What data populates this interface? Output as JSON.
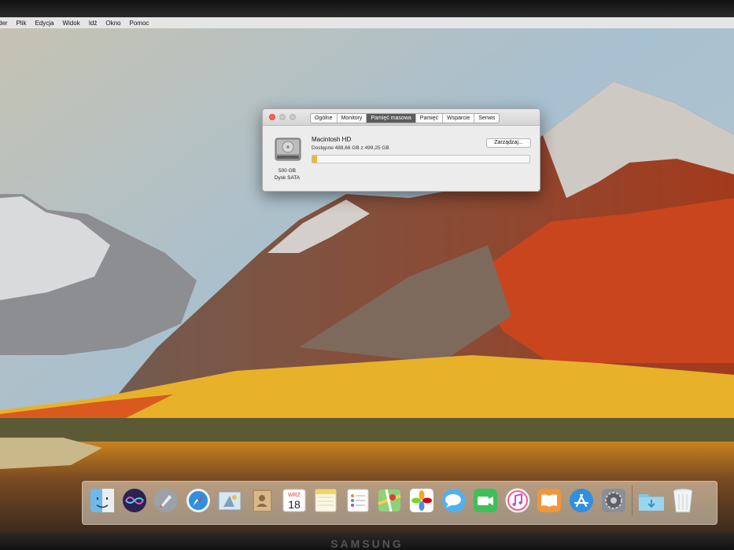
{
  "menubar": {
    "items": [
      "der",
      "Plik",
      "Edycja",
      "Widok",
      "Idź",
      "Okno",
      "Pomoc"
    ]
  },
  "about_window": {
    "tabs": [
      "Ogólne",
      "Monitory",
      "Pamięć masowa",
      "Pamięć",
      "Wsparcie",
      "Serwis"
    ],
    "active_tab": "Pamięć masowa",
    "disk": {
      "icon": "hard-drive-icon",
      "size_label": "500 GB",
      "type_label": "Dysk SATA"
    },
    "volume": {
      "name": "Macintosh HD",
      "available": "Dostępne 488,66 GB z 499,25 GB",
      "used_fraction": 0.021
    },
    "manage_button": "Zarządzaj..."
  },
  "dock": {
    "icons": [
      "finder-icon",
      "siri-icon",
      "launchpad-icon",
      "safari-icon",
      "mail-icon",
      "contacts-icon",
      "calendar-icon",
      "notes-icon",
      "reminders-icon",
      "maps-icon",
      "photos-icon",
      "messages-icon",
      "facetime-icon",
      "itunes-icon",
      "ibooks-icon",
      "app-store-icon",
      "system-preferences-icon",
      "downloads-folder-icon",
      "trash-icon"
    ],
    "calendar": {
      "month": "WRZ",
      "day": "18"
    }
  },
  "monitor_brand": "SAMSUNG",
  "colors": {
    "usage_fill": "#e6b73a",
    "active_tab": "#5c5c5c",
    "close_button": "#fc5f57"
  }
}
